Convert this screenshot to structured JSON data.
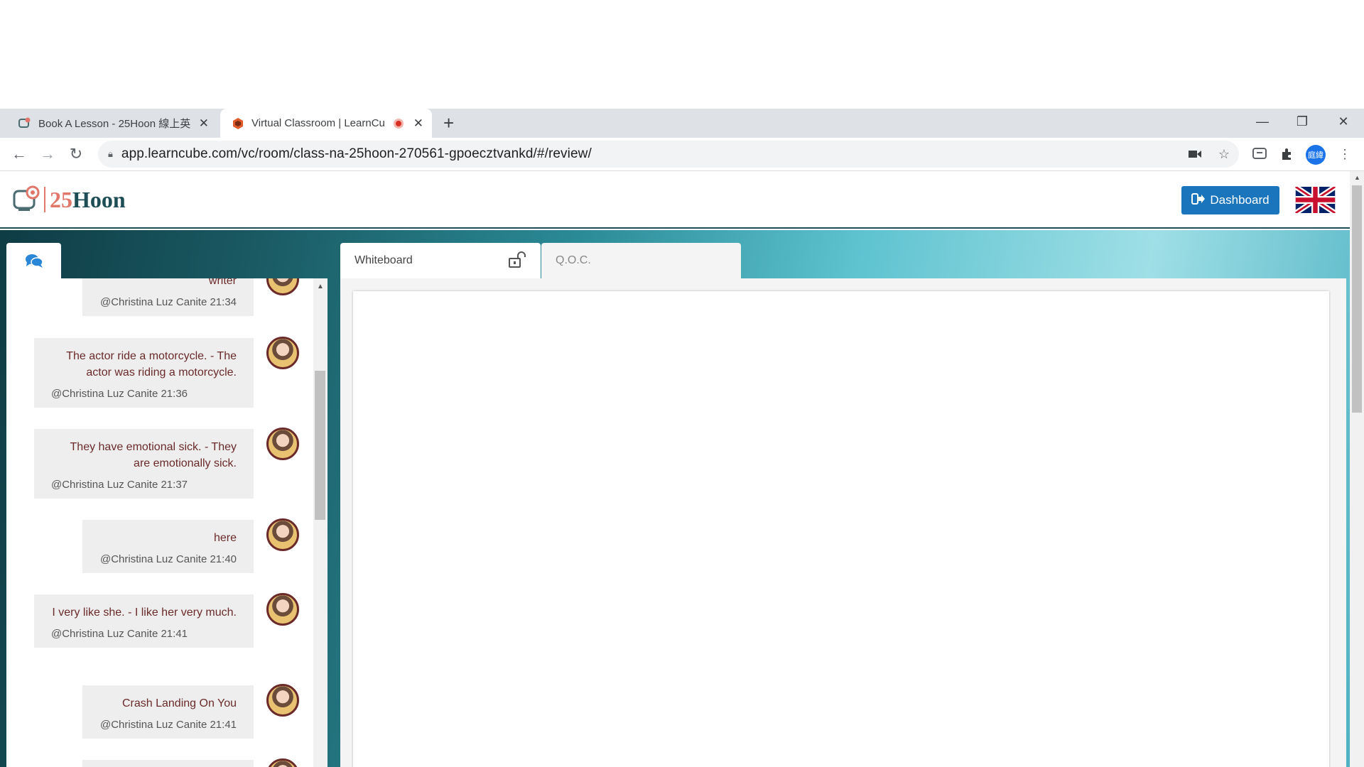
{
  "browser": {
    "tabs": [
      {
        "title": "Book A Lesson - 25Hoon 線上英",
        "active": false
      },
      {
        "title": "Virtual Classroom | LearnCu",
        "active": true
      }
    ],
    "url": "app.learncube.com/vc/room/class-na-25hoon-270561-gpoecztvankd/#/review/",
    "profile_initials": "庭緯"
  },
  "header": {
    "logo_number": "25",
    "logo_word": "Hoon",
    "dashboard_label": "Dashboard"
  },
  "tabs": {
    "whiteboard": "Whiteboard",
    "qoc": "Q.O.C."
  },
  "chat": {
    "messages": [
      {
        "text": "writer",
        "meta": "@Christina Luz Canite 21:34"
      },
      {
        "text": "The actor ride a motorcycle. - The actor was riding a motorcycle.",
        "meta": "@Christina Luz Canite 21:36"
      },
      {
        "text": "They have emotional sick. - They are emotionally sick.",
        "meta": "@Christina Luz Canite 21:37"
      },
      {
        "text": "here",
        "meta": "@Christina Luz Canite 21:40"
      },
      {
        "text": "I very like she. - I like her very much.",
        "meta": "@Christina Luz Canite 21:41"
      },
      {
        "text": "Crash Landing On You",
        "meta": "@Christina Luz Canite 21:41"
      }
    ]
  },
  "colors": {
    "brand_teal": "#1d4d55",
    "brand_coral": "#e0776a",
    "dashboard_blue": "#1b75bc"
  }
}
